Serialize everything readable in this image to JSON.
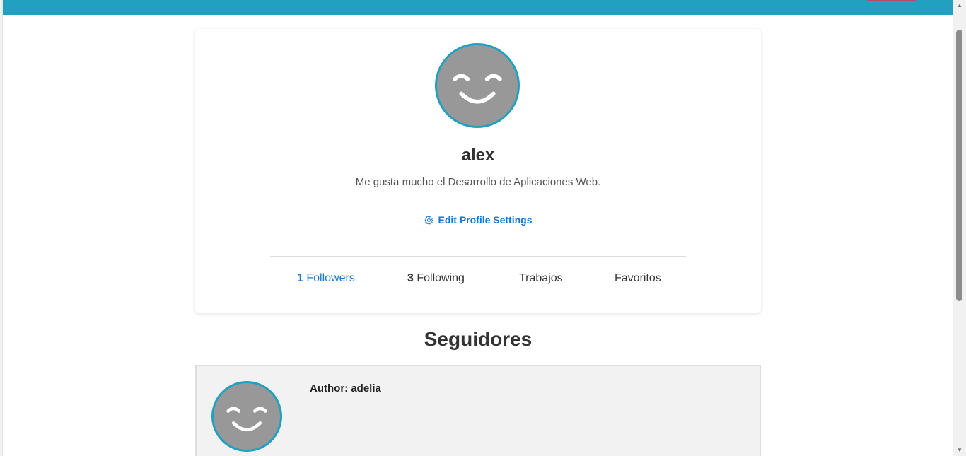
{
  "profile": {
    "username": "alex",
    "bio": "Me gusta mucho el Desarrollo de Aplicaciones Web.",
    "edit_label": "Edit Profile Settings",
    "stats": [
      {
        "count": "1",
        "label": "Followers",
        "active": true
      },
      {
        "count": "3",
        "label": "Following",
        "active": false
      },
      {
        "count": "",
        "label": "Trabajos",
        "active": false
      },
      {
        "count": "",
        "label": "Favoritos",
        "active": false
      }
    ]
  },
  "followers_section": {
    "title": "Seguidores",
    "items": [
      {
        "author": "Author: adelia"
      }
    ]
  },
  "icons": {
    "avatar": "smiley-face-icon",
    "edit": "gear-icon"
  },
  "colors": {
    "topbar": "#21a0bf",
    "accent": "#1976d2",
    "avatar_bg": "#989898",
    "avatar_border": "#21a0bf",
    "follower_card_bg": "#f2f2f2"
  }
}
